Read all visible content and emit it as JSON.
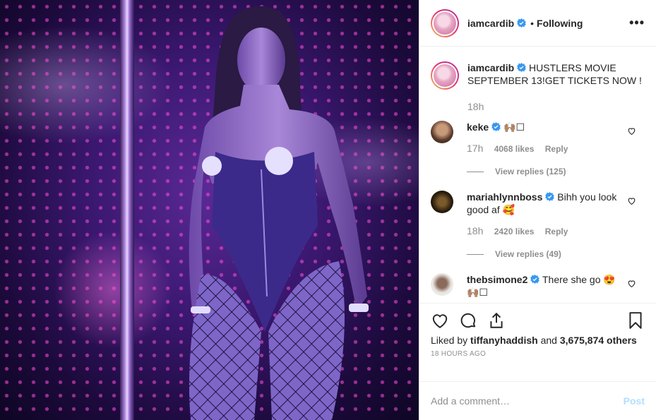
{
  "post": {
    "username": "iamcardib",
    "follow_sep": "•",
    "follow_status": "Following",
    "more": "•••"
  },
  "caption": {
    "username": "iamcardib",
    "text": "HUSTLERS MOVIE SEPTEMBER 13!GET TICKETS NOW !",
    "time": "18h"
  },
  "comments": [
    {
      "username": "keke",
      "text": "🙌🏽☐",
      "time": "17h",
      "likes": "4068 likes",
      "reply": "Reply",
      "view_replies": "View replies (125)"
    },
    {
      "username": "mariahlynnboss",
      "text": "Bihh you look good af 🥰",
      "time": "18h",
      "likes": "2420 likes",
      "reply": "Reply",
      "view_replies": "View replies (49)"
    },
    {
      "username": "thebsimone2",
      "text": "There she go 😍🙌🏽☐"
    }
  ],
  "likes": {
    "prefix": "Liked by ",
    "user": "tiffanyhaddish",
    "middle": " and ",
    "others": "3,675,874 others"
  },
  "time_ago": "18 HOURS AGO",
  "comment_box": {
    "placeholder": "Add a comment…",
    "post_label": "Post"
  },
  "colors": {
    "verified": "#3897f0",
    "post_disabled": "#b2dffc",
    "muted": "#8e8e8e"
  }
}
